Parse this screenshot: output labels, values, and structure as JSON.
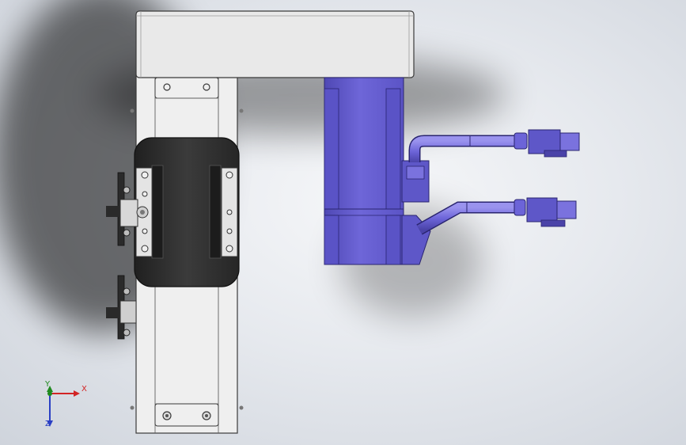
{
  "viewport": {
    "background_style": "soft-gray-gradient",
    "model": {
      "frame_color": "#e8e8e8",
      "rail_color": "#efefef",
      "carriage_color": "#2f2f2f",
      "motor_color": "#6b63d4",
      "motor_dark": "#4a43a8",
      "cable_color": "#7a72de",
      "edge_color": "#3a3a3a"
    }
  },
  "triad": {
    "x_label": "X",
    "y_label": "Y",
    "z_label": "Z",
    "x_color": "#d22424",
    "y_color": "#1f8a1f",
    "z_color": "#2a3fc4"
  }
}
